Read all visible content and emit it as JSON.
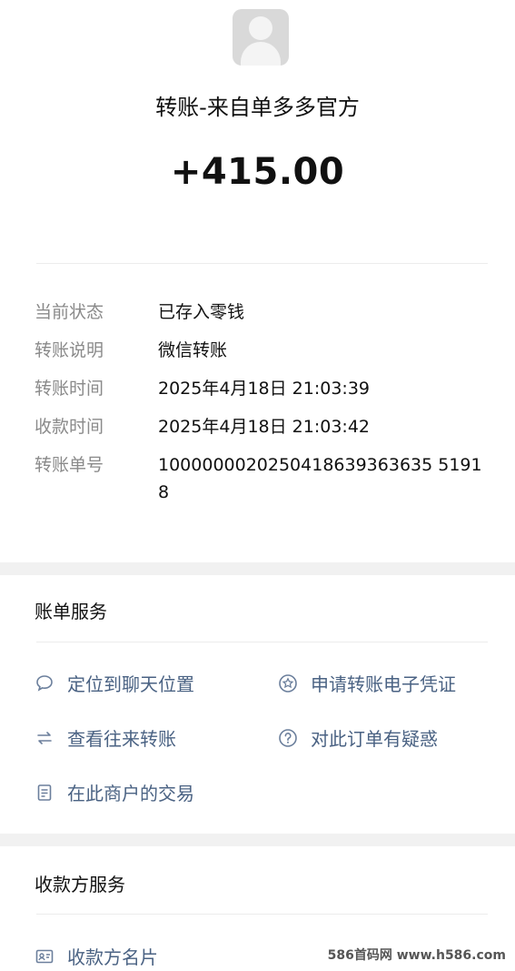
{
  "header": {
    "title": "转账-来自单多多官方",
    "amount": "+415.00"
  },
  "details": [
    {
      "label": "当前状态",
      "value": "已存入零钱"
    },
    {
      "label": "转账说明",
      "value": "微信转账"
    },
    {
      "label": "转账时间",
      "value": "2025年4月18日 21:03:39"
    },
    {
      "label": "收款时间",
      "value": "2025年4月18日 21:03:42"
    },
    {
      "label": "转账单号",
      "value": "1000000020250418639363635 51918"
    }
  ],
  "bill_services": {
    "title": "账单服务",
    "items": [
      {
        "label": "定位到聊天位置",
        "icon": "chat-bubble-icon"
      },
      {
        "label": "申请转账电子凭证",
        "icon": "badge-star-icon"
      },
      {
        "label": "查看往来转账",
        "icon": "swap-arrows-icon"
      },
      {
        "label": "对此订单有疑惑",
        "icon": "question-circle-icon"
      },
      {
        "label": "在此商户的交易",
        "icon": "document-icon"
      }
    ]
  },
  "payee_services": {
    "title": "收款方服务",
    "items": [
      {
        "label": "收款方名片",
        "icon": "contact-card-icon"
      }
    ]
  },
  "watermark": "586首码网 www.h586.com"
}
